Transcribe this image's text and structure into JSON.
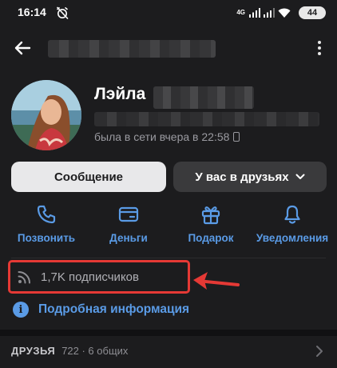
{
  "status_bar": {
    "time": "16:14",
    "network": "4G",
    "battery": "44"
  },
  "profile": {
    "first_name": "Лэйла",
    "last_seen": "была в сети вчера в 22:58"
  },
  "buttons": {
    "message": "Сообщение",
    "friend_status": "У вас в друзьях"
  },
  "actions": [
    {
      "label": "Позвонить",
      "icon": "phone-icon"
    },
    {
      "label": "Деньги",
      "icon": "money-icon"
    },
    {
      "label": "Подарок",
      "icon": "gift-icon"
    },
    {
      "label": "Уведомления",
      "icon": "bell-icon"
    }
  ],
  "followers": {
    "text": "1,7K подписчиков",
    "icon": "rss-icon"
  },
  "details": {
    "label": "Подробная информация",
    "icon_glyph": "i"
  },
  "friends": {
    "title": "ДРУЗЬЯ",
    "count": "722 · 6 общих"
  },
  "colors": {
    "background": "#1c1c1e",
    "accent": "#5a9be6",
    "highlight": "#e53935"
  }
}
